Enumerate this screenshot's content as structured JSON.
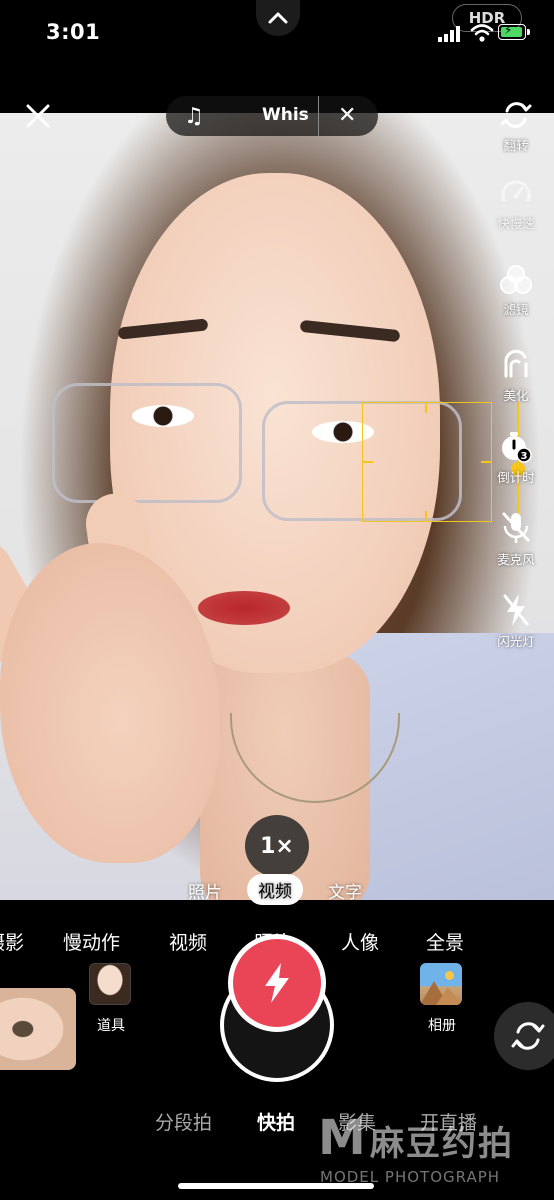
{
  "status_bar": {
    "time": "3:01",
    "hdr": "HDR"
  },
  "top_bar": {
    "music_name": "Whis"
  },
  "tools": [
    {
      "id": "flip",
      "label": "翻转",
      "icon": "flip-camera-icon"
    },
    {
      "id": "speed",
      "label": "快慢速",
      "icon": "speedometer-icon"
    },
    {
      "id": "filter",
      "label": "滤镜",
      "icon": "filter-icon"
    },
    {
      "id": "beauty",
      "label": "美化",
      "icon": "beauty-icon"
    },
    {
      "id": "timer",
      "label": "倒计时",
      "icon": "timer-icon",
      "badge": "3"
    },
    {
      "id": "mic",
      "label": "麦克风",
      "icon": "mic-off-icon"
    },
    {
      "id": "flash",
      "label": "闪光灯",
      "icon": "flash-off-icon"
    }
  ],
  "zoom": "1×",
  "submodes": [
    "照片",
    "视频",
    "文字"
  ],
  "submode_selected": "视频",
  "modes": [
    "摄影",
    "慢动作",
    "视频",
    "照片",
    "人像",
    "全景"
  ],
  "props_label": "道具",
  "album_label": "相册",
  "capture_tabs": [
    "分段拍",
    "快拍",
    "影集",
    "开直播"
  ],
  "capture_selected": "快拍",
  "watermark": {
    "letter": "M",
    "chinese": "麻豆约拍",
    "english": "MODEL PHOTOGRAPH"
  },
  "colors": {
    "shutter": "#ea4457",
    "focus": "#f5c518"
  }
}
